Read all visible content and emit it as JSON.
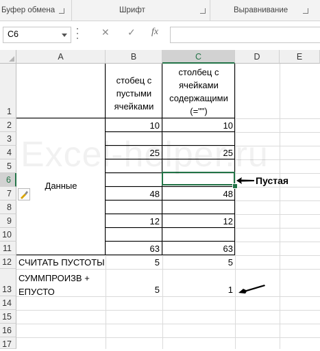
{
  "ribbon": {
    "clipboard": "Буфер обмена",
    "font": "Шрифт",
    "alignment": "Выравнивание"
  },
  "formula_bar": {
    "name_box": "C6",
    "cancel_icon": "✕",
    "enter_icon": "✓",
    "fx": "fx",
    "content": ""
  },
  "columns": [
    "A",
    "B",
    "C",
    "D",
    "E"
  ],
  "rows": [
    "1",
    "2",
    "3",
    "4",
    "5",
    "6",
    "7",
    "8",
    "9",
    "10",
    "11",
    "12",
    "13",
    "14",
    "15",
    "16",
    "17"
  ],
  "headers": {
    "b1_lines": [
      "стобец с",
      "пустыми",
      "ячейками"
    ],
    "c1_lines": [
      "столбец с",
      "ячейками",
      "содержащими",
      "(=\"\")"
    ]
  },
  "merged_label": "Данные",
  "values_b": [
    "10",
    "",
    "25",
    "",
    "",
    "48",
    "",
    "12",
    "",
    "63"
  ],
  "values_c": [
    "10",
    "",
    "25",
    "",
    "",
    "48",
    "",
    "12",
    "",
    "63"
  ],
  "row12": {
    "a": "СЧИТАТЬ ПУСТОТЫ",
    "b": "5",
    "c": "5"
  },
  "row13": {
    "a_line1": "СУММПРОИЗВ +",
    "a_line2": "ЕПУСТО",
    "b": "5",
    "c": "1"
  },
  "annotation": "Пустая",
  "watermark": "Excel-helper.ru",
  "colors": {
    "accent": "#217346",
    "header_bg": "#f0f0f0",
    "grid": "#dadada"
  }
}
